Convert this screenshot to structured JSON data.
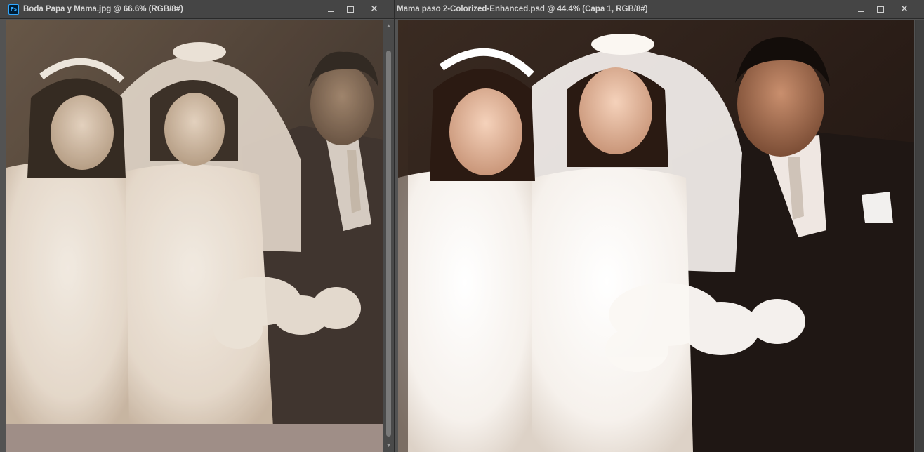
{
  "left_window": {
    "title": "Boda Papa y Mama.jpg @ 66.6% (RGB/8#)",
    "app_icon_label": "Ps",
    "photo_description": "Original faded sepia wedding photograph: bridesmaid, bride with veil holding bouquet, groom in dark suit"
  },
  "right_window": {
    "title": "Mama paso 2-Colorized-Enhanced.psd @ 44.4% (Capa 1, RGB/8#)",
    "photo_description": "Colorized and enhanced version of the same wedding photograph"
  },
  "controls": {
    "minimize_glyph": "",
    "maximize_glyph": "",
    "close_glyph": "✕",
    "scroll_up": "▲",
    "scroll_down": "▼"
  },
  "colors": {
    "chrome_dark": "#2b2b2b",
    "titlebar": "#454545",
    "title_text": "#d6d6d6",
    "ps_blue": "#31a8ff"
  },
  "icons": [
    "photoshop-icon",
    "minimize-icon",
    "maximize-icon",
    "close-icon",
    "scroll-up-icon",
    "scroll-down-icon"
  ]
}
